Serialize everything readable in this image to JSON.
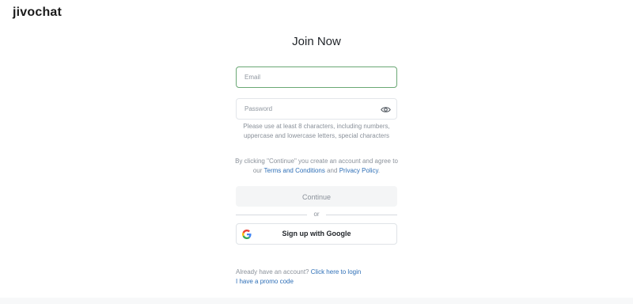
{
  "brand": {
    "logo_text": "jivochat",
    "accent_color": "#2bb35b"
  },
  "form": {
    "title": "Join Now",
    "email_placeholder": "Email",
    "password_placeholder": "Password",
    "password_icon": "eye-icon",
    "password_hint": "Please use at least 8 characters, including numbers, uppercase and lowercase letters, special characters",
    "terms_prefix": "By clicking \"Continue\" you create an account and agree to our",
    "terms_link": "Terms and Conditions",
    "terms_and": "and",
    "privacy_link": "Privacy Policy",
    "terms_suffix": ".",
    "continue_label": "Continue",
    "divider_label": "or",
    "google_label": "Sign up with Google",
    "google_icon": "google-icon"
  },
  "footer": {
    "login_prompt": "Already have an account?",
    "login_link": "Click here to login",
    "promo_link": "I have a promo code"
  },
  "colors": {
    "link": "#2e6fb7",
    "email_border_focus": "#6aa874",
    "muted_text": "#8a919a",
    "continue_bg": "#f4f5f6"
  }
}
